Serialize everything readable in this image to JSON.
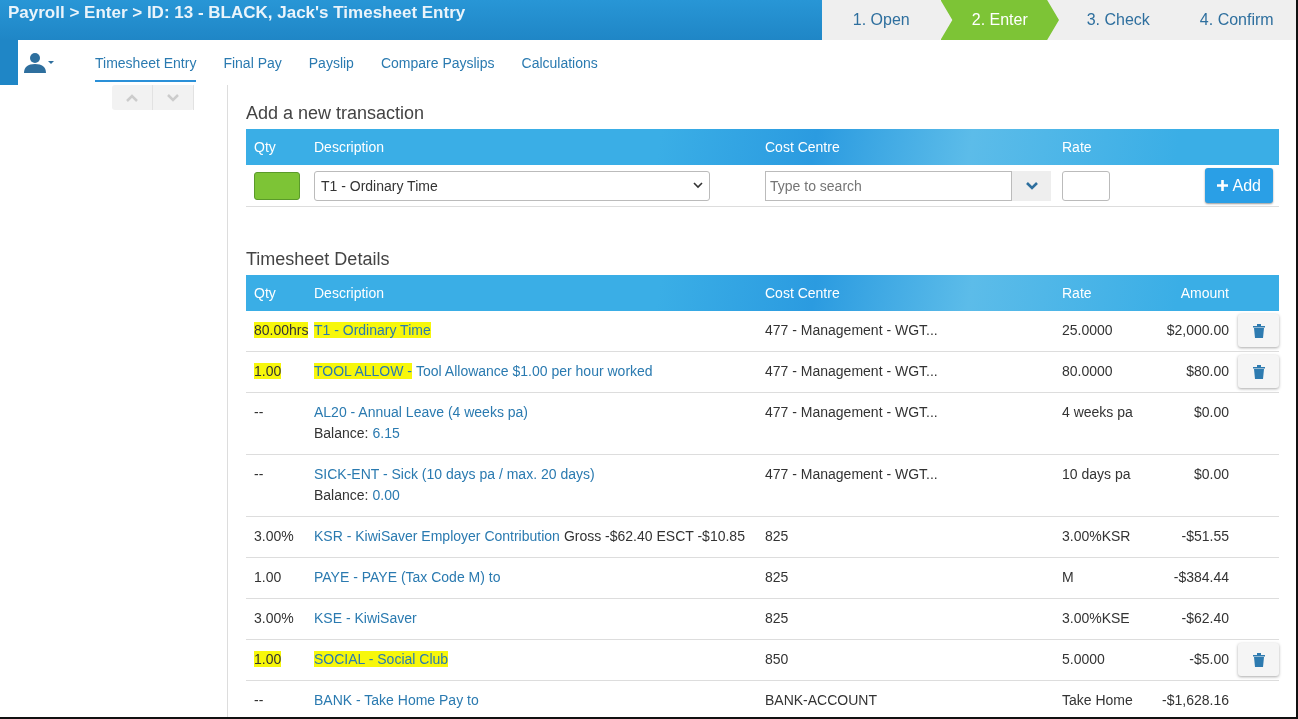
{
  "header": {
    "title": "Payroll > Enter > ID: 13 - BLACK, Jack's Timesheet Entry"
  },
  "steps": [
    {
      "label": "1. Open",
      "selected": false
    },
    {
      "label": "2. Enter",
      "selected": true
    },
    {
      "label": "3. Check",
      "selected": false
    },
    {
      "label": "4. Confirm",
      "selected": false
    }
  ],
  "tabs": [
    {
      "label": "Timesheet Entry",
      "selected": true
    },
    {
      "label": "Final Pay",
      "selected": false
    },
    {
      "label": "Payslip",
      "selected": false
    },
    {
      "label": "Compare Payslips",
      "selected": false
    },
    {
      "label": "Calculations",
      "selected": false
    }
  ],
  "new_transaction": {
    "title": "Add a new transaction",
    "columns": [
      "Qty",
      "Description",
      "Cost Centre",
      "Rate"
    ],
    "description_value": "T1 - Ordinary Time",
    "cost_centre_placeholder": "Type to search",
    "add_button": "Add"
  },
  "details": {
    "title": "Timesheet Details",
    "columns": [
      "Qty",
      "Description",
      "Cost Centre",
      "Rate",
      "Amount"
    ],
    "rows": [
      {
        "qty": "80.00hrs",
        "qty_highlighted": true,
        "description": [
          {
            "text": "T1 - Ordinary Time",
            "highlighted": true
          }
        ],
        "cost_centre": "477 - Management - WGT...",
        "rate": "25.0000",
        "amount": "$2,000.00",
        "deletable": true
      },
      {
        "qty": "1.00",
        "qty_highlighted": true,
        "description": [
          {
            "text": "TOOL ALLOW -",
            "highlighted": true
          },
          {
            "text": "Tool Allowance $1.00 per hour worked",
            "highlighted": false
          }
        ],
        "cost_centre": "477 - Management - WGT...",
        "rate": "80.0000",
        "amount": "$80.00",
        "deletable": true
      },
      {
        "qty": "--",
        "qty_highlighted": false,
        "description": [
          {
            "text": "AL20 - Annual Leave (4 weeks pa)",
            "highlighted": false
          }
        ],
        "balance_label": "Balance:",
        "balance": "6.15",
        "cost_centre": "477 - Management - WGT...",
        "rate": "4 weeks pa",
        "amount": "$0.00",
        "deletable": false
      },
      {
        "qty": "--",
        "qty_highlighted": false,
        "description": [
          {
            "text": "SICK-ENT - Sick (10 days pa / max. 20 days)",
            "highlighted": false
          }
        ],
        "balance_label": "Balance:",
        "balance": "0.00",
        "cost_centre": "477 - Management - WGT...",
        "rate": "10 days pa",
        "amount": "$0.00",
        "deletable": false
      },
      {
        "qty": "3.00%",
        "qty_highlighted": false,
        "description": [
          {
            "text": "KSR - KiwiSaver Employer Contribution",
            "highlighted": false
          }
        ],
        "note": "Gross -$62.40 ESCT -$10.85",
        "cost_centre": "825",
        "rate": "3.00%KSR",
        "amount": "-$51.55",
        "deletable": false
      },
      {
        "qty": "1.00",
        "qty_highlighted": false,
        "description": [
          {
            "text": "PAYE - PAYE (Tax Code M) to",
            "highlighted": false
          }
        ],
        "cost_centre": "825",
        "rate": "M",
        "amount": "-$384.44",
        "deletable": false
      },
      {
        "qty": "3.00%",
        "qty_highlighted": false,
        "description": [
          {
            "text": "KSE - KiwiSaver",
            "highlighted": false
          }
        ],
        "cost_centre": "825",
        "rate": "3.00%KSE",
        "amount": "-$62.40",
        "deletable": false
      },
      {
        "qty": "1.00",
        "qty_highlighted": true,
        "description": [
          {
            "text": "SOCIAL - Social Club",
            "highlighted": true
          }
        ],
        "cost_centre": "850",
        "rate": "5.0000",
        "amount": "-$5.00",
        "deletable": true
      },
      {
        "qty": "--",
        "qty_highlighted": false,
        "description": [
          {
            "text": "BANK - Take Home Pay to",
            "highlighted": false
          }
        ],
        "cost_centre": "BANK-ACCOUNT",
        "rate": "Take Home",
        "amount": "-$1,628.16",
        "deletable": false
      }
    ]
  }
}
